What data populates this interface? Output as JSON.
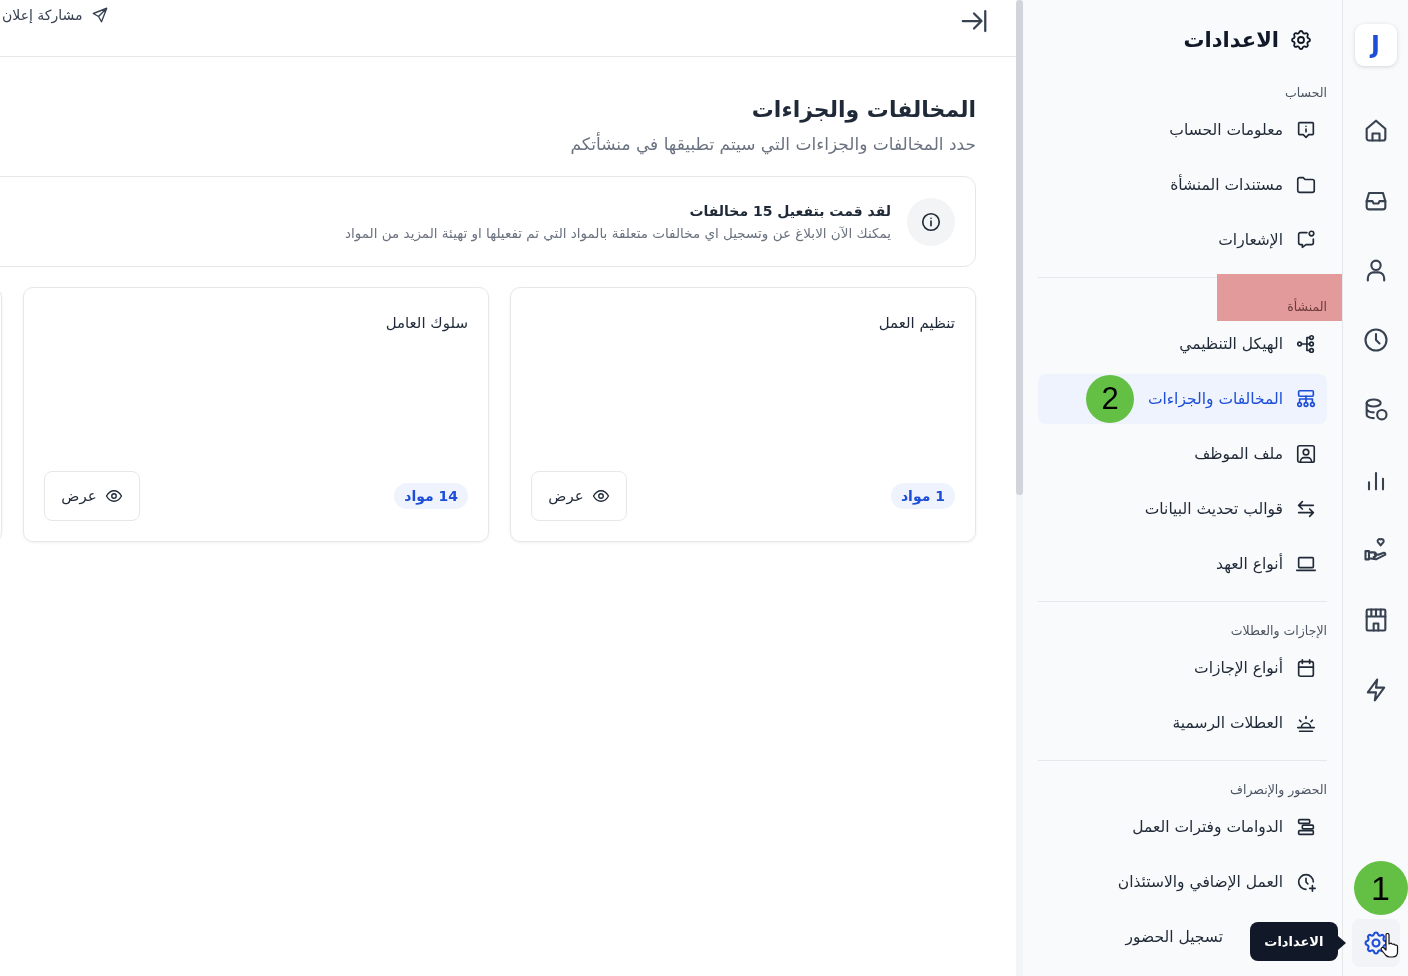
{
  "header": {
    "share_label": "مشاركة إعلان"
  },
  "page": {
    "title": "المخالفات والجزاءات",
    "subtitle": "حدد المخالفات والجزاءات التي سيتم تطبيقها في منشأتكم"
  },
  "notice": {
    "title": "لقد قمت بتفعيل 15 مخالفات",
    "text": "يمكنك الآن الابلاغ عن وتسجيل اي مخالفات متعلقة بالمواد التي تم تفعيلها او تهيئة المزيد من المواد"
  },
  "cards": [
    {
      "title": "تنظيم العمل",
      "count": "1 مواد",
      "view_label": "عرض"
    },
    {
      "title": "سلوك العامل",
      "count": "14 مواد",
      "view_label": "عرض"
    }
  ],
  "settings": {
    "title": "الاعدادات",
    "sections": [
      {
        "heading": "الحساب",
        "highlighted": false,
        "items": [
          {
            "label": "معلومات الحساب",
            "selected": false
          },
          {
            "label": "مستندات المنشأة",
            "selected": false
          },
          {
            "label": "الإشعارات",
            "selected": false
          }
        ]
      },
      {
        "heading": "المنشأة",
        "highlighted": true,
        "items": [
          {
            "label": "الهيكل التنظيمي",
            "selected": false
          },
          {
            "label": "المخالفات والجزاءات",
            "selected": true,
            "marker": "2"
          },
          {
            "label": "ملف الموظف",
            "selected": false
          },
          {
            "label": "قوالب تحديث البيانات",
            "selected": false
          },
          {
            "label": "أنواع العهد",
            "selected": false
          }
        ]
      },
      {
        "heading": "الإجازات والعطلات",
        "highlighted": false,
        "items": [
          {
            "label": "أنواع الإجازات",
            "selected": false
          },
          {
            "label": "العطلات الرسمية",
            "selected": false
          }
        ]
      },
      {
        "heading": "الحضور والإنصراف",
        "highlighted": false,
        "items": [
          {
            "label": "الدوامات وفترات العمل",
            "selected": false
          },
          {
            "label": "العمل الإضافي والاستئذان",
            "selected": false
          },
          {
            "label": "تسجيل الحضور",
            "selected": false
          }
        ]
      }
    ]
  },
  "rail": {
    "logo": "J",
    "items": [
      {
        "selected": false
      },
      {
        "selected": false
      },
      {
        "selected": false
      },
      {
        "selected": false
      },
      {
        "selected": false
      },
      {
        "selected": false
      },
      {
        "selected": false
      },
      {
        "selected": false
      },
      {
        "selected": false
      },
      {
        "selected": true,
        "marker": "1"
      }
    ]
  },
  "tooltip": {
    "text": "الاعدادات"
  }
}
